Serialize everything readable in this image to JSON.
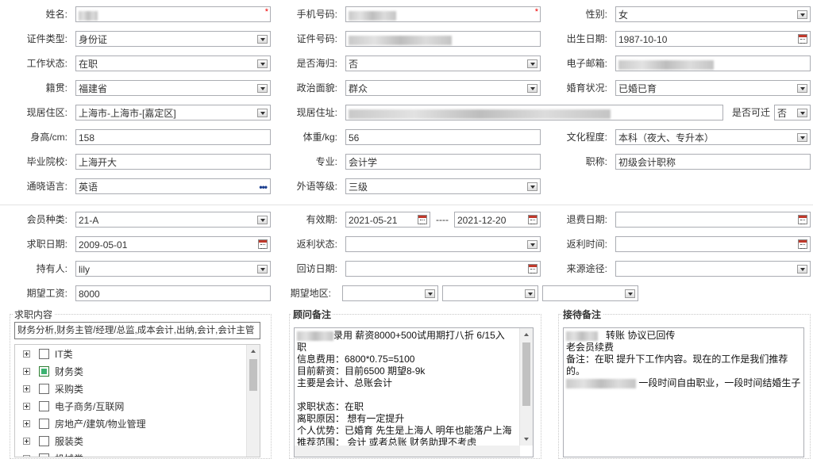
{
  "row1": {
    "name_label": "姓名:",
    "phone_label": "手机号码:",
    "gender_label": "性别:",
    "gender_value": "女",
    "required_mark": "*"
  },
  "row2": {
    "idtype_label": "证件类型:",
    "idtype_value": "身份证",
    "idno_label": "证件号码:",
    "birth_label": "出生日期:",
    "birth_value": "1987-10-10"
  },
  "row3": {
    "work_label": "工作状态:",
    "work_value": "在职",
    "overseas_label": "是否海归:",
    "overseas_value": "否",
    "email_label": "电子邮箱:"
  },
  "row4": {
    "native_label": "籍贯:",
    "native_value": "福建省",
    "political_label": "政治面貌:",
    "political_value": "群众",
    "marital_label": "婚育状况:",
    "marital_value": "已婚已育"
  },
  "row5": {
    "residence_label": "现居住区:",
    "residence_value": "上海市-上海市-[嘉定区]",
    "address_label": "现居住址:",
    "relocate_label": "是否可迁",
    "relocate_value": "否"
  },
  "row6": {
    "height_label": "身高/cm:",
    "height_value": "158",
    "weight_label": "体重/kg:",
    "weight_value": "56",
    "edu_label": "文化程度:",
    "edu_value": "本科（夜大、专升本）"
  },
  "row7": {
    "school_label": "毕业院校:",
    "school_value": "上海开大",
    "major_label": "专业:",
    "major_value": "会计学",
    "title_label": "职称:",
    "title_value": "初级会计职称"
  },
  "row8": {
    "language_label": "通晓语言:",
    "language_value": "英语",
    "language_more": "•••",
    "foreign_label": "外语等级:",
    "foreign_value": "三级"
  },
  "row9": {
    "member_label": "会员种类:",
    "member_value": "21-A",
    "valid_label": "有效期:",
    "valid_from": "2021-05-21",
    "valid_sep": "----",
    "valid_to": "2021-12-20",
    "refund_label": "退费日期:"
  },
  "row10": {
    "jobdate_label": "求职日期:",
    "jobdate_value": "2009-05-01",
    "rebate_status_label": "返利状态:",
    "rebate_time_label": "返利时间:"
  },
  "row11": {
    "holder_label": "持有人:",
    "holder_value": "lily",
    "revisit_label": "回访日期:",
    "source_label": "来源途径:"
  },
  "row12": {
    "salary_label": "期望工资:",
    "salary_value": "8000",
    "area_label": "期望地区:"
  },
  "job_panel": {
    "title": "求职内容",
    "summary": "财务分析,财务主管/经理/总监,成本会计,出纳,会计,会计主管",
    "items": [
      {
        "label": "IT类",
        "checked": false
      },
      {
        "label": "财务类",
        "checked": true
      },
      {
        "label": "采购类",
        "checked": false
      },
      {
        "label": "电子商务/互联网",
        "checked": false
      },
      {
        "label": "房地产/建筑/物业管理",
        "checked": false
      },
      {
        "label": "服装类",
        "checked": false
      },
      {
        "label": "机械类",
        "checked": false
      }
    ]
  },
  "advisor_panel": {
    "title": "顾问备注",
    "lines": [
      "录用  薪资8000+500试用期打八折  6/15入",
      "职",
      "信息费用：6800*0.75=5100",
      "目前薪资：目前6500 期望8-9k",
      "主要是会计、总账会计",
      "",
      "求职状态：在职",
      "离职原因：  想有一定提升",
      "个人优势：已婚育 先生是上海人 明年也能落户上海",
      "推荐范围：  会计 或者总账 财务助理不考虑"
    ]
  },
  "reception_panel": {
    "title": "接待备注",
    "lines": [
      "转账 协议已回传",
      "老会员续费",
      "备注：在职 提升下工作内容。现在的工作是我们推荐",
      "的。",
      "一段时间自由职业，一段时间结婚生子"
    ]
  }
}
